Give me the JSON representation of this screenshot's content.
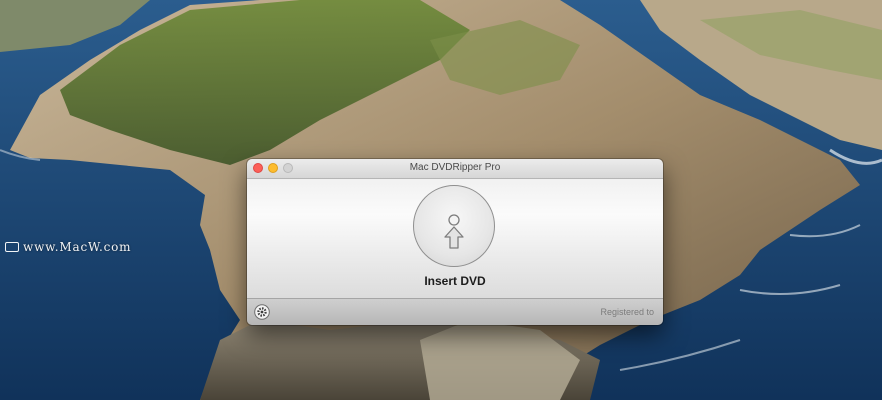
{
  "desktop": {
    "watermark_text": "www.MacW.com"
  },
  "window": {
    "title": "Mac DVDRipper Pro",
    "insert_label": "Insert DVD",
    "registered_text": "Registered to",
    "icons": {
      "close": "close-icon",
      "minimize": "minimize-icon",
      "maximize": "maximize-icon",
      "disc": "disc-eject-icon",
      "settings": "gear-icon"
    }
  },
  "colors": {
    "close": "#fc5f57",
    "minimize": "#fdbc2e",
    "maximize": "#d3d3d3",
    "sea": "#1d4a78"
  }
}
